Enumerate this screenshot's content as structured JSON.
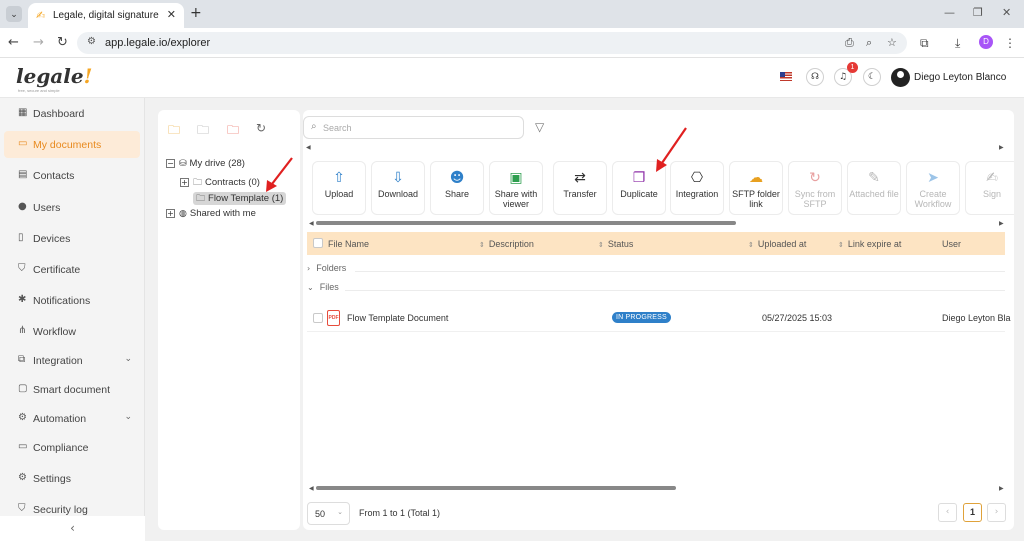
{
  "browser": {
    "tab_title": "Legale, digital signature",
    "url": "app.legale.io/explorer"
  },
  "header": {
    "logo": "legale",
    "logo_tagline": "free, secure and simple",
    "notification_count": "1",
    "user_name": "Diego Leyton Blanco"
  },
  "sidebar": {
    "items": [
      {
        "label": "Dashboard",
        "icon": "dashboard-icon"
      },
      {
        "label": "My documents",
        "icon": "folder-icon",
        "active": true
      },
      {
        "label": "Contacts",
        "icon": "address-book-icon"
      },
      {
        "label": "Users",
        "icon": "user-circle-icon"
      },
      {
        "label": "Devices",
        "icon": "device-icon"
      },
      {
        "label": "Certificate",
        "icon": "shield-check-icon"
      },
      {
        "label": "Notifications",
        "icon": "bell-icon"
      },
      {
        "label": "Workflow",
        "icon": "workflow-icon"
      },
      {
        "label": "Integration",
        "icon": "external-link-icon",
        "expandable": true
      },
      {
        "label": "Smart document",
        "icon": "document-icon"
      },
      {
        "label": "Automation",
        "icon": "gear-icon",
        "expandable": true
      },
      {
        "label": "Compliance",
        "icon": "chat-icon"
      },
      {
        "label": "Settings",
        "icon": "settings-icon"
      },
      {
        "label": "Security log",
        "icon": "shield-icon"
      }
    ]
  },
  "tree": {
    "my_drive": "My drive (28)",
    "contracts": "Contracts (0)",
    "flow_template": "Flow Template (1)",
    "shared": "Shared with me"
  },
  "search": {
    "placeholder": "Search"
  },
  "actions": [
    {
      "label": "Upload",
      "icon": "upload-icon",
      "enabled": true
    },
    {
      "label": "Download",
      "icon": "download-icon",
      "enabled": true
    },
    {
      "label": "Share",
      "icon": "user-plus-icon",
      "enabled": true
    },
    {
      "label": "Share with viewer",
      "icon": "image-share-icon",
      "enabled": true
    },
    {
      "label": "Transfer",
      "icon": "transfer-icon",
      "enabled": true
    },
    {
      "label": "Duplicate",
      "icon": "duplicate-icon",
      "enabled": true
    },
    {
      "label": "Integration",
      "icon": "integration-icon",
      "enabled": true
    },
    {
      "label": "SFTP folder link",
      "icon": "cloud-link-icon",
      "enabled": true
    },
    {
      "label": "Sync from SFTP",
      "icon": "sync-icon",
      "enabled": false
    },
    {
      "label": "Attached file",
      "icon": "paperclip-icon",
      "enabled": false
    },
    {
      "label": "Create Workflow",
      "icon": "send-icon",
      "enabled": false
    },
    {
      "label": "Sign",
      "icon": "sign-icon",
      "enabled": false
    }
  ],
  "table": {
    "columns": [
      "File Name",
      "Description",
      "Status",
      "Uploaded at",
      "Link expire at",
      "User"
    ],
    "groups": {
      "folders": "Folders",
      "files": "Files"
    },
    "rows": [
      {
        "file_name": "Flow Template Document",
        "description": "",
        "status": "IN PROGRESS",
        "uploaded_at": "05/27/2025 15:03",
        "link_expire_at": "",
        "user": "Diego Leyton Bla"
      }
    ]
  },
  "pagination": {
    "page_size": "50",
    "info": "From 1 to 1 (Total 1)",
    "current_page": "1"
  },
  "colors": {
    "accent": "#e88a1f",
    "table_header": "#fde4c3",
    "status_in_progress": "#2f80c9",
    "annotation_arrow": "#e02020"
  }
}
